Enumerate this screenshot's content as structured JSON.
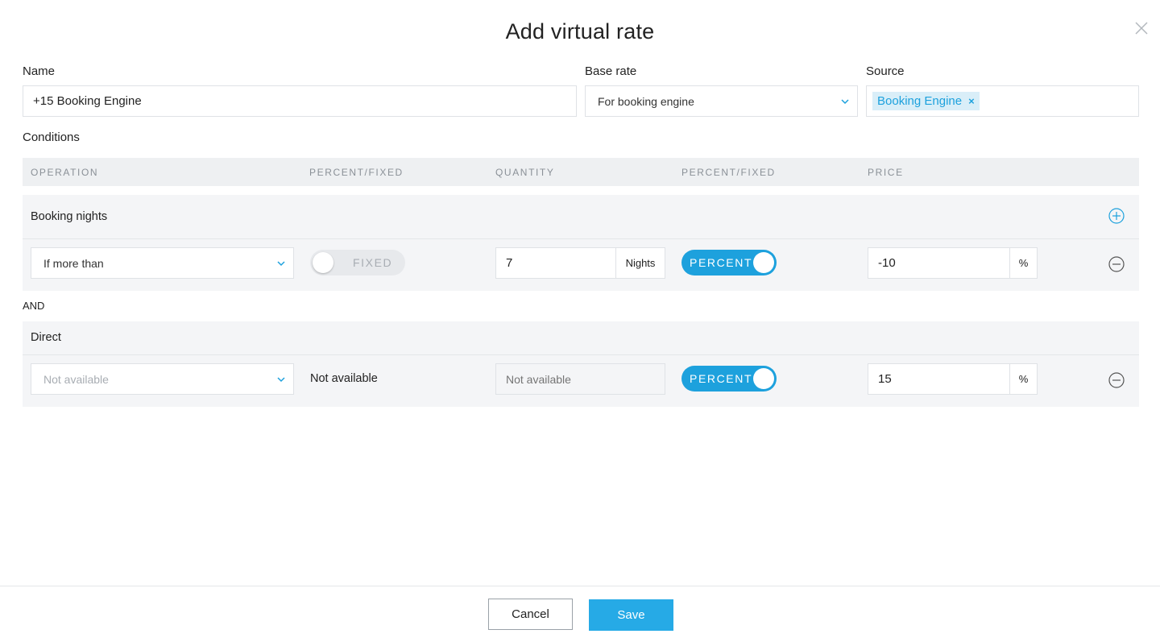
{
  "modal": {
    "title": "Add virtual rate"
  },
  "form": {
    "name_label": "Name",
    "name_value": "+15 Booking Engine",
    "base_rate_label": "Base rate",
    "base_rate_value": "For booking engine",
    "source_label": "Source",
    "source_tags": [
      "Booking Engine"
    ],
    "source_tag_remove": "×"
  },
  "conditions": {
    "label": "Conditions",
    "columns": [
      "OPERATION",
      "PERCENT/FIXED",
      "QUANTITY",
      "PERCENT/FIXED",
      "PRICE"
    ],
    "connector": "AND",
    "groups": [
      {
        "title": "Booking nights",
        "operation": "If more than",
        "quantity_type_toggle": "FIXED",
        "quantity_type_on": false,
        "quantity_value": "7",
        "quantity_unit": "Nights",
        "price_type_toggle": "PERCENT",
        "price_type_on": true,
        "price_value": "-10",
        "price_unit": "%"
      },
      {
        "title": "Direct",
        "operation_placeholder": "Not available",
        "quantity_type_text": "Not available",
        "quantity_placeholder": "Not available",
        "price_type_toggle": "PERCENT",
        "price_type_on": true,
        "price_value": "15",
        "price_unit": "%"
      }
    ]
  },
  "footer": {
    "cancel_label": "Cancel",
    "save_label": "Save"
  },
  "colors": {
    "accent": "#1da1dd",
    "primary_button": "#26aae6",
    "tag_background": "#d9eef8",
    "row_background": "#f4f5f7",
    "header_background": "#eef0f2"
  },
  "icons": {
    "close": "close-icon",
    "dropdown": "chevron-down-icon",
    "add_condition": "plus-circle-icon",
    "remove_condition": "minus-circle-icon"
  }
}
